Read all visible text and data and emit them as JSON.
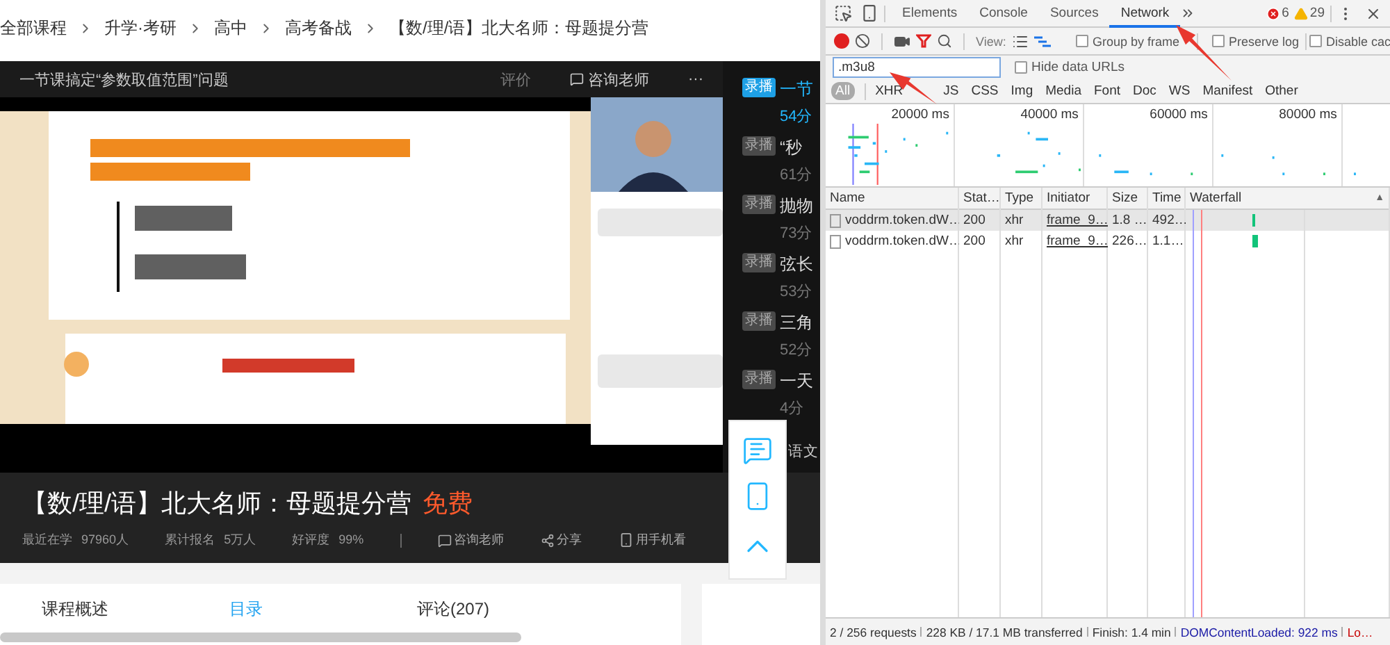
{
  "breadcrumb": [
    "全部课程",
    "升学·考研",
    "高中",
    "高考备战",
    "【数/理/语】北大名师：母题提分营"
  ],
  "lesson_bar": {
    "title": "一节课搞定“参数取值范围”问题",
    "rate": "评价",
    "consult": "咨询老师",
    "more": "···"
  },
  "video": {
    "kind": "picture"
  },
  "playlist": [
    {
      "tag": "录播",
      "title": "一节",
      "duration": "54分",
      "selected": true
    },
    {
      "tag": "录播",
      "title": "“秒",
      "duration": "61分",
      "selected": false
    },
    {
      "tag": "录播",
      "title": "抛物",
      "duration": "73分",
      "selected": false
    },
    {
      "tag": "录播",
      "title": "弦长",
      "duration": "53分",
      "selected": false
    },
    {
      "tag": "录播",
      "title": "三角",
      "duration": "52分",
      "selected": false
    },
    {
      "tag": "录播",
      "title": "一天",
      "duration": "4分",
      "selected": false
    }
  ],
  "playlist_tail": "语文",
  "course": {
    "title": "【数/理/语】北大名师：母题提分营",
    "price": "免费",
    "stats": [
      {
        "label": "最近在学",
        "value": "97960人"
      },
      {
        "label": "累计报名",
        "value": "5万人"
      },
      {
        "label": "好评度",
        "value": "99%"
      }
    ],
    "actions": [
      {
        "kind": "consult",
        "label": "咨询老师"
      },
      {
        "kind": "share",
        "label": "分享"
      },
      {
        "kind": "phone",
        "label": "用手机看"
      }
    ]
  },
  "course_tabs": [
    {
      "label": "课程概述",
      "selected": false
    },
    {
      "label": "目录",
      "selected": true
    },
    {
      "label": "评论(207)",
      "selected": false
    }
  ],
  "side_tools": [
    {
      "kind": "comment"
    },
    {
      "kind": "phone"
    },
    {
      "kind": "top"
    }
  ],
  "devtools": {
    "tabs": [
      {
        "label": "Elements",
        "selected": false
      },
      {
        "label": "Console",
        "selected": false
      },
      {
        "label": "Sources",
        "selected": false
      },
      {
        "label": "Network",
        "selected": true
      }
    ],
    "errors": "6",
    "warnings": "29",
    "recording": true,
    "filter_active": true,
    "view_label": "View:",
    "options": [
      {
        "label": "Group by frame",
        "checked": false
      },
      {
        "label": "Preserve log",
        "checked": false
      },
      {
        "label": "Disable cac",
        "checked": false
      }
    ],
    "filter": {
      "value": ".m3u8"
    },
    "hide_data_urls": {
      "label": "Hide data URLs",
      "checked": false
    },
    "types": [
      {
        "label": "All",
        "selected": true
      },
      {
        "label": "XHR",
        "selected": false
      },
      {
        "label": "JS",
        "selected": false
      },
      {
        "label": "CSS",
        "selected": false
      },
      {
        "label": "Img",
        "selected": false
      },
      {
        "label": "Media",
        "selected": false
      },
      {
        "label": "Font",
        "selected": false
      },
      {
        "label": "Doc",
        "selected": false
      },
      {
        "label": "WS",
        "selected": false
      },
      {
        "label": "Manifest",
        "selected": false
      },
      {
        "label": "Other",
        "selected": false
      }
    ],
    "timeline_ticks": [
      "20000 ms",
      "40000 ms",
      "60000 ms",
      "80000 ms"
    ],
    "columns": [
      "Name",
      "Stat…",
      "Type",
      "Initiator",
      "Size",
      "Time",
      "Waterfall"
    ],
    "sort_indicator": "▲",
    "rows": [
      {
        "name": "voddrm.token.dW…",
        "status": "200",
        "type": "xhr",
        "initiator": "frame_9…",
        "size": "1.8 …",
        "time": "492…",
        "selected": true
      },
      {
        "name": "voddrm.token.dW…",
        "status": "200",
        "type": "xhr",
        "initiator": "frame_9…",
        "size": "226…",
        "time": "1.1…",
        "selected": false
      }
    ],
    "status": [
      {
        "text": "2 / 256 requests",
        "kind": "plain"
      },
      {
        "text": "228 KB / 17.1 MB transferred",
        "kind": "plain"
      },
      {
        "text": "Finish: 1.4 min",
        "kind": "plain"
      },
      {
        "text": "DOMContentLoaded: 922 ms",
        "kind": "dom"
      },
      {
        "text": "Lo…",
        "kind": "load"
      }
    ]
  }
}
